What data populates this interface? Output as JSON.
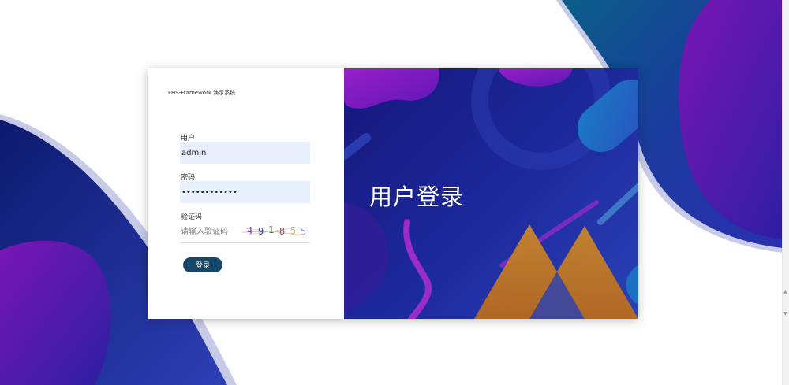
{
  "app": {
    "title": "FHS-Framework 演示系统"
  },
  "form": {
    "user_label": "用户",
    "user_value": "admin",
    "password_label": "密码",
    "password_value": "••••••••••••",
    "captcha_label": "验证码",
    "captcha_placeholder": "请输入验证码",
    "captcha_chars": [
      "4",
      "9",
      "1",
      "8",
      "5",
      "5"
    ],
    "login_button": "登录"
  },
  "hero": {
    "title": "用户登录"
  },
  "colors": {
    "button": "#14476a",
    "input_bg": "#e8f0fe",
    "hero_bg": "#1d2a9d",
    "accent_orange": "#c8862a",
    "accent_purple": "#8a1fc7"
  }
}
